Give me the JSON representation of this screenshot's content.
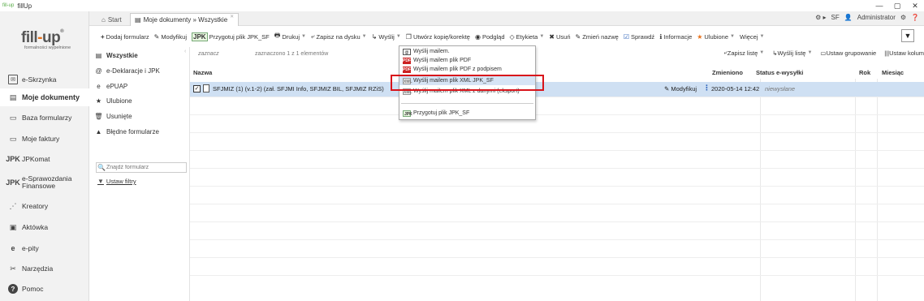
{
  "window": {
    "title": "fillUp",
    "logo_mini": "fill-up",
    "controls": {
      "minimize": "—",
      "maximize": "▢",
      "close": "✕"
    }
  },
  "logo": {
    "brand_left": "fill",
    "brand_hyphen": "-",
    "brand_right": "up",
    "reg": "®",
    "tagline": "formalności wypełnione"
  },
  "sidebar": {
    "items": [
      {
        "label": "e-Skrzynka",
        "icon": "inbox-icon",
        "glyph": "✉"
      },
      {
        "label": "Moje dokumenty",
        "icon": "documents-icon",
        "glyph": "▤"
      },
      {
        "label": "Baza formularzy",
        "icon": "forms-base-icon",
        "glyph": "▭"
      },
      {
        "label": "Moje faktury",
        "icon": "invoices-icon",
        "glyph": "▭"
      },
      {
        "label": "JPKomat",
        "icon": "jpk-icon",
        "glyph": "JPK"
      },
      {
        "label_line1": "e-Sprawozdania",
        "label_line2": "Finansowe",
        "icon": "financial-reports-icon",
        "glyph": "JPK"
      },
      {
        "label": "Kreatory",
        "icon": "wizard-icon",
        "glyph": "⋰"
      },
      {
        "label": "Aktówka",
        "icon": "briefcase-icon",
        "glyph": "▣"
      },
      {
        "label": "e-pity",
        "icon": "epity-icon",
        "glyph": "e"
      },
      {
        "label": "Narzędzia",
        "icon": "tools-icon",
        "glyph": "✂"
      },
      {
        "label": "Pomoc",
        "icon": "help-icon",
        "glyph": "?"
      }
    ]
  },
  "tabs": [
    {
      "label": "Start",
      "icon": "home-icon"
    },
    {
      "label": "Moje dokumenty » Wszystkie",
      "icon": "documents-tab-icon",
      "close": "✕"
    }
  ],
  "user_area": {
    "env": "SF",
    "user": "Administrator"
  },
  "toolbar": {
    "add": "Dodaj formularz",
    "modify": "Modyfikuj",
    "jpk_badge": "JPK",
    "prepare_jpk": "Przygotuj plik JPK_SF",
    "print": "Drukuj",
    "save_disk": "Zapisz na dysku",
    "send": "Wyślij",
    "copy": "Utwórz kopię/korektę",
    "preview": "Podgląd",
    "label": "Etykieta",
    "delete": "Usuń",
    "rename": "Zmień nazwę",
    "check": "Sprawdź",
    "info": "Informacje",
    "favorites": "Ulubione",
    "more": "Więcej"
  },
  "folders": {
    "items": [
      {
        "label": "Wszystkie",
        "icon": "all-folder-icon",
        "glyph": "▤"
      },
      {
        "label": "e-Deklaracje i JPK",
        "icon": "edeklaracje-icon",
        "glyph": "@"
      },
      {
        "label": "ePUAP",
        "icon": "epuap-icon",
        "glyph": "e"
      },
      {
        "label": "Ulubione",
        "icon": "star-icon",
        "glyph": "★"
      },
      {
        "label": "Usunięte",
        "icon": "trash-icon",
        "glyph": "🗑"
      },
      {
        "label": "Błędne formularze",
        "icon": "warning-icon",
        "glyph": "▲"
      }
    ],
    "search_placeholder": "Znajdź formularz",
    "set_filters": "Ustaw filtry"
  },
  "selection": {
    "select": "zaznacz",
    "selected_info": "zaznaczono 1 z 1 elementów"
  },
  "list_actions": {
    "save_list": "Zapisz listę",
    "send_list": "Wyślij listę",
    "grouping": "Ustaw grupowanie",
    "columns": "Ustaw kolum"
  },
  "grid": {
    "headers": {
      "name": "Nazwa",
      "changed": "Zmieniono",
      "status": "Status e-wysyłki",
      "year": "Rok",
      "month": "Miesiąc"
    },
    "rows": [
      {
        "checked": "✓",
        "name": "SFJMIZ (1) (v.1-2) (zał. SFJMI Info, SFJMIZ BIL, SFJMIZ RZiS)",
        "modify": "Modyfikuj",
        "dots": "⋮",
        "changed": "2020-05-14 12:42",
        "status": "niewysłane"
      }
    ]
  },
  "dropdown": {
    "items": [
      {
        "label": "Wyślij mailem.",
        "icon": "mail-icon",
        "badge": "@"
      },
      {
        "label": "Wyślij mailem plik PDF",
        "icon": "pdf-icon",
        "badge": "PDF"
      },
      {
        "label": "Wyślij mailem plik PDF z podpisem",
        "icon": "pdf-signed-icon",
        "badge": "PDF"
      },
      {
        "label": "Wyślij mailem plik XML JPK_SF",
        "icon": "xml-icon",
        "badge": "XML"
      },
      {
        "label": "Wyślij mailem plik XML z danymi (eksport)",
        "icon": "xml-export-icon",
        "badge": "XML"
      },
      {
        "label": "Przygotuj plik JPK_SF",
        "icon": "jpk-file-icon",
        "badge": "JPK"
      }
    ],
    "highlighted_index": 3
  },
  "colors": {
    "accent_orange": "#e8711a",
    "highlight_red": "#d8141b",
    "selected_row": "#cfe0f3"
  }
}
